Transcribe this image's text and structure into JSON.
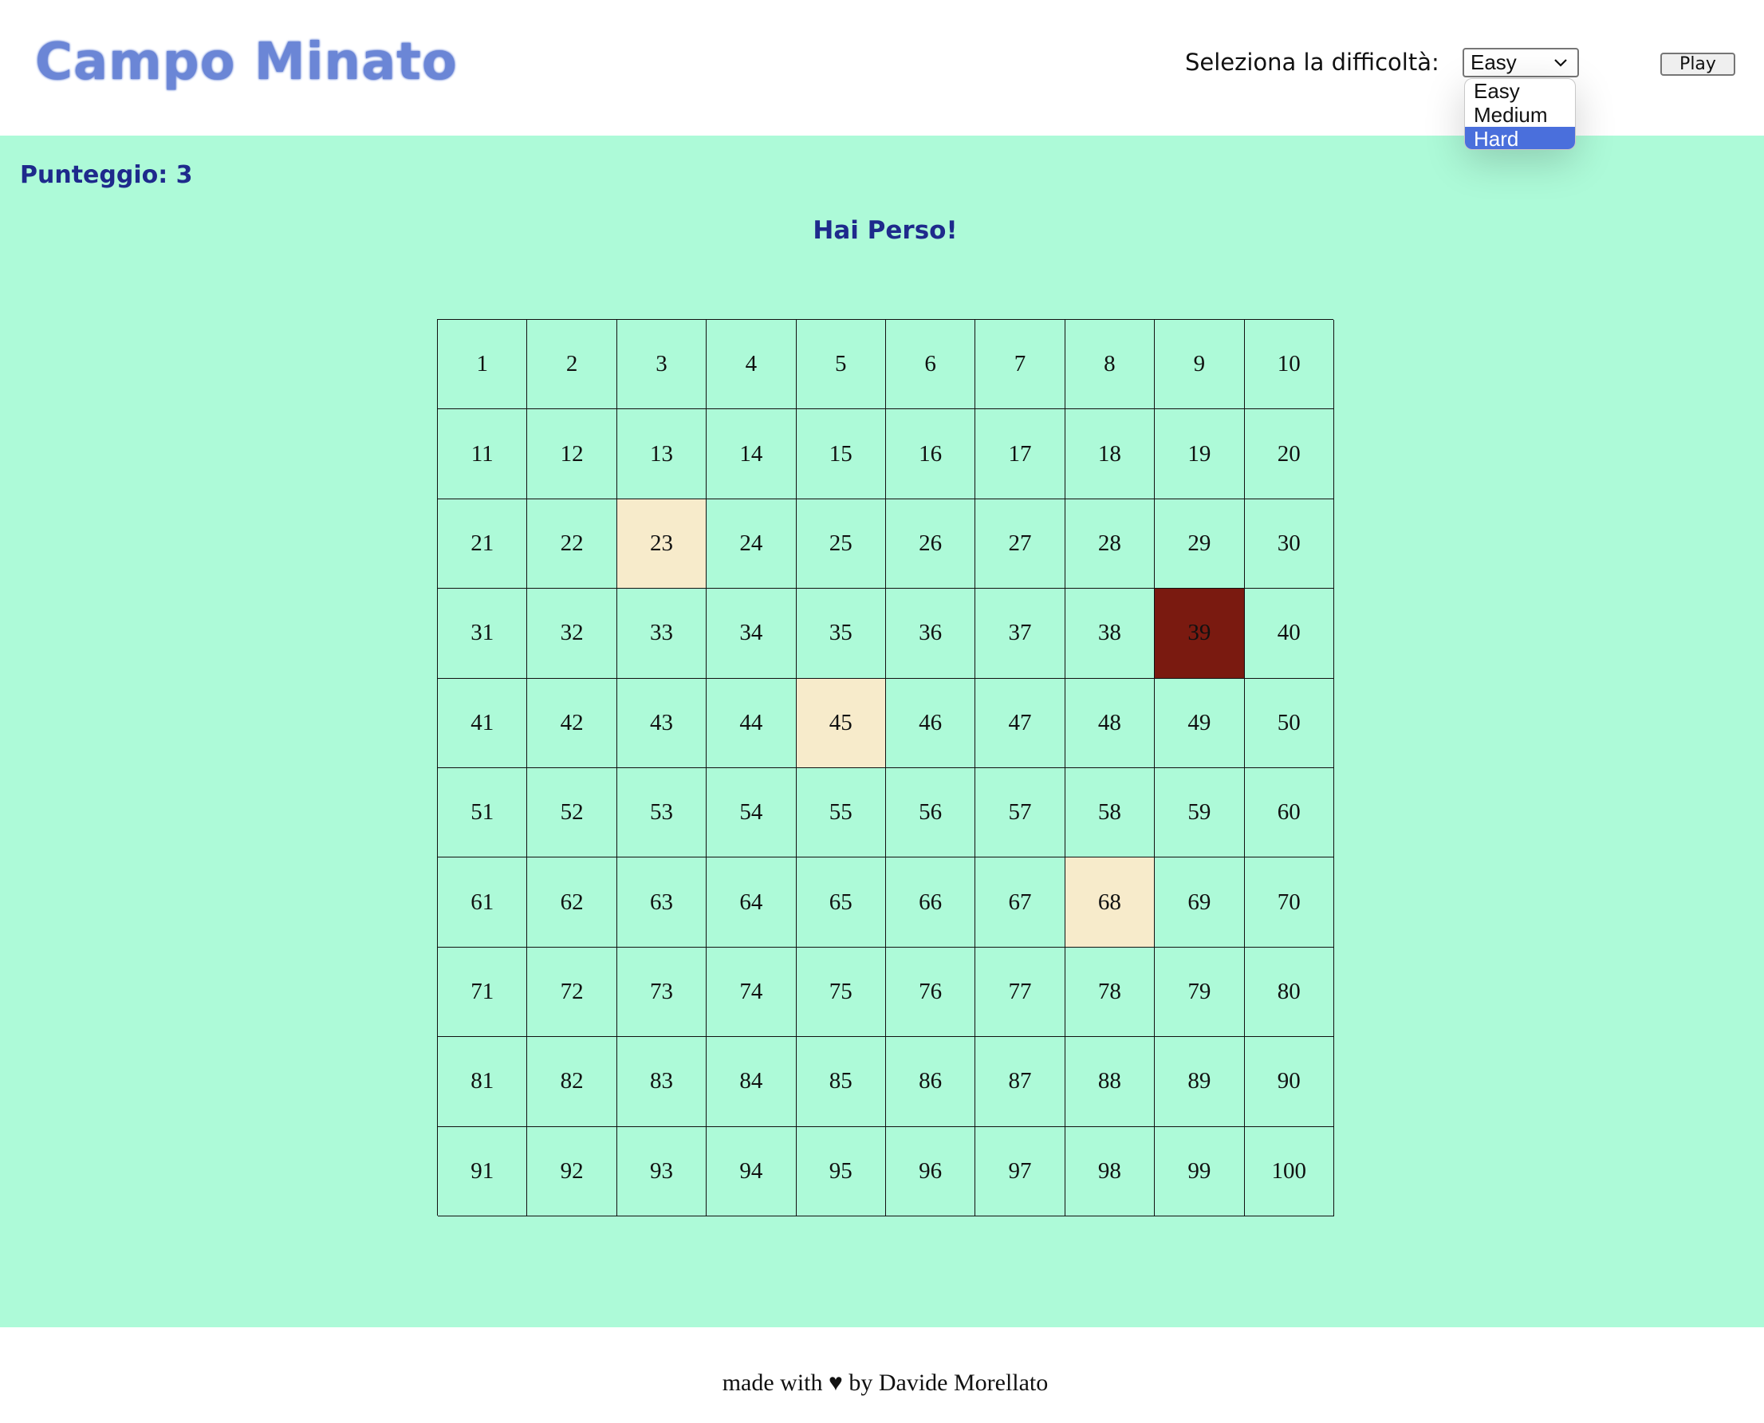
{
  "header": {
    "title": "Campo Minato",
    "difficulty_label": "Seleziona la difficoltà:",
    "difficulty_selected": "Easy",
    "difficulty_options": [
      "Easy",
      "Medium",
      "Hard"
    ],
    "highlighted_option": "Hard",
    "play_label": "Play"
  },
  "game": {
    "score_text": "Punteggio: 3",
    "result_message": "Hai Perso!",
    "rows": 10,
    "cols": 10,
    "cells": [
      1,
      2,
      3,
      4,
      5,
      6,
      7,
      8,
      9,
      10,
      11,
      12,
      13,
      14,
      15,
      16,
      17,
      18,
      19,
      20,
      21,
      22,
      23,
      24,
      25,
      26,
      27,
      28,
      29,
      30,
      31,
      32,
      33,
      34,
      35,
      36,
      37,
      38,
      39,
      40,
      41,
      42,
      43,
      44,
      45,
      46,
      47,
      48,
      49,
      50,
      51,
      52,
      53,
      54,
      55,
      56,
      57,
      58,
      59,
      60,
      61,
      62,
      63,
      64,
      65,
      66,
      67,
      68,
      69,
      70,
      71,
      72,
      73,
      74,
      75,
      76,
      77,
      78,
      79,
      80,
      81,
      82,
      83,
      84,
      85,
      86,
      87,
      88,
      89,
      90,
      91,
      92,
      93,
      94,
      95,
      96,
      97,
      98,
      99,
      100
    ],
    "revealed_safe": [
      23,
      45,
      68
    ],
    "exploded_bomb": [
      39
    ]
  },
  "colors": {
    "board_bg": "#adfad8",
    "safe_cell": "#f7ebcb",
    "bomb_cell": "#7a1a10",
    "title": "#6b86d6",
    "accent_text": "#1e2a8c"
  },
  "footer": {
    "text": "made with ♥ by Davide Morellato"
  }
}
